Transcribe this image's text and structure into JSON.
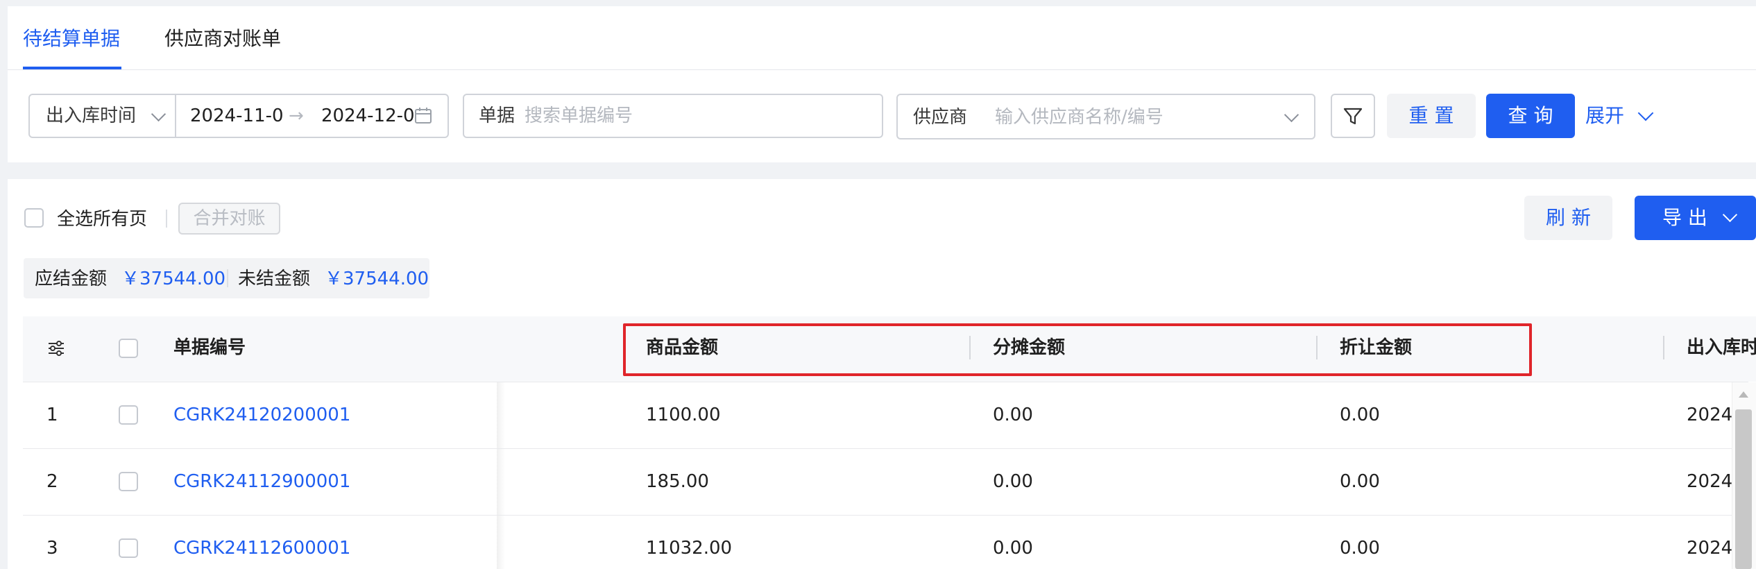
{
  "tabs": [
    {
      "label": "待结算单据",
      "active": true
    },
    {
      "label": "供应商对账单",
      "active": false
    }
  ],
  "filters": {
    "date_type": "出入库时间",
    "date_start": "2024-11-0",
    "date_arrow": "→",
    "date_end": "2024-12-0",
    "doc_label": "单据",
    "doc_placeholder": "搜索单据编号",
    "supplier_label": "供应商",
    "supplier_placeholder": "输入供应商名称/编号",
    "reset": "重 置",
    "query": "查 询",
    "expand": "展开"
  },
  "toolbar": {
    "select_all": "全选所有页",
    "merge": "合并对账",
    "refresh": "刷 新",
    "export": "导 出"
  },
  "summary": {
    "due_label": "应结金额",
    "due_value": "￥37544.00",
    "unsettled_label": "未结金额",
    "unsettled_value": "￥37544.00"
  },
  "table": {
    "headers": [
      "单据编号",
      "商品金额",
      "分摊金额",
      "折让金额",
      "出入库时"
    ],
    "rows": [
      {
        "index": "1",
        "doc_no": "CGRK24120200001",
        "goods": "1100.00",
        "alloc": "0.00",
        "discount": "0.00",
        "time": "2024-"
      },
      {
        "index": "2",
        "doc_no": "CGRK24112900001",
        "goods": "185.00",
        "alloc": "0.00",
        "discount": "0.00",
        "time": "2024-"
      },
      {
        "index": "3",
        "doc_no": "CGRK24112600001",
        "goods": "11032.00",
        "alloc": "0.00",
        "discount": "0.00",
        "time": "2024-"
      }
    ]
  },
  "colors": {
    "accent": "#1f5ef0",
    "highlight_border": "#e0252a",
    "page_bg": "#f0f2f5"
  }
}
